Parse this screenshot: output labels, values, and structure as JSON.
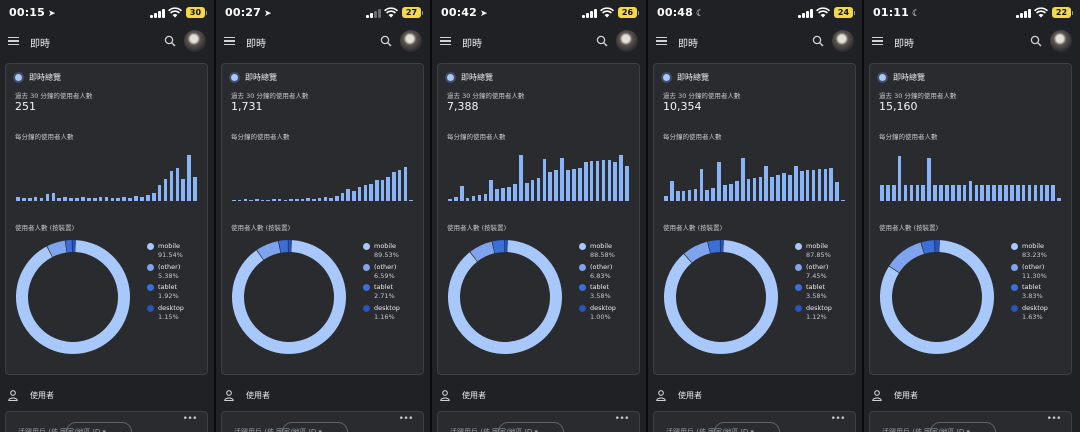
{
  "colors": {
    "accent": "#a8c7fa",
    "bar": "#8ab4f8",
    "mobile": "#a8c7fa",
    "other": "#7ea4ee",
    "tablet": "#3b6ed8",
    "desktop": "#2753bd"
  },
  "screens": [
    {
      "status": {
        "time": "00:15",
        "glyph": "location-arrow",
        "glyph_char": "➤",
        "battery": "30",
        "signal_bars": 4
      },
      "appbar": {
        "title": "即時"
      },
      "card": {
        "title": "即時總覽",
        "sub_label": "過去 30 分鐘的使用者人數",
        "total": "251",
        "per_min_label": "每分鐘的使用者人數",
        "bars": [
          0.08,
          0.06,
          0.06,
          0.08,
          0.06,
          0.14,
          0.16,
          0.06,
          0.08,
          0.06,
          0.06,
          0.08,
          0.06,
          0.06,
          0.08,
          0.08,
          0.06,
          0.06,
          0.08,
          0.06,
          0.1,
          0.08,
          0.12,
          0.16,
          0.3,
          0.42,
          0.56,
          0.62,
          0.42,
          0.86,
          0.46
        ],
        "device_label": "使用者人數 (按裝置)",
        "devices": {
          "mobile": 91.54,
          "other": 5.38,
          "tablet": 1.92,
          "desktop": 1.15
        },
        "legend": [
          {
            "key": "mobile",
            "name": "mobile",
            "pct": "91.54%"
          },
          {
            "key": "other",
            "name": "(other)",
            "pct": "5.38%"
          },
          {
            "key": "tablet",
            "name": "tablet",
            "pct": "1.92%"
          },
          {
            "key": "desktop",
            "name": "desktop",
            "pct": "1.15%"
          }
        ]
      },
      "users_label": "使用者",
      "bottom": {
        "text": "活躍用戶 (依   國家/地區 ID ▾",
        "more": "•••"
      }
    },
    {
      "status": {
        "time": "00:27",
        "glyph": "location-arrow",
        "glyph_char": "➤",
        "battery": "27",
        "signal_bars": 2
      },
      "appbar": {
        "title": "即時"
      },
      "card": {
        "title": "即時總覽",
        "sub_label": "過去 30 分鐘的使用者人數",
        "total": "1,731",
        "per_min_label": "每分鐘的使用者人數",
        "bars": [
          0.02,
          0.02,
          0.04,
          0.02,
          0.03,
          0.02,
          0.02,
          0.04,
          0.03,
          0.02,
          0.03,
          0.03,
          0.04,
          0.06,
          0.03,
          0.06,
          0.08,
          0.06,
          0.1,
          0.16,
          0.22,
          0.18,
          0.26,
          0.3,
          0.32,
          0.4,
          0.4,
          0.46,
          0.54,
          0.58,
          0.64,
          0.02
        ],
        "device_label": "使用者人數 (按裝置)",
        "devices": {
          "mobile": 89.53,
          "other": 6.59,
          "tablet": 2.71,
          "desktop": 1.16
        },
        "legend": [
          {
            "key": "mobile",
            "name": "mobile",
            "pct": "89.53%"
          },
          {
            "key": "other",
            "name": "(other)",
            "pct": "6.59%"
          },
          {
            "key": "tablet",
            "name": "tablet",
            "pct": "2.71%"
          },
          {
            "key": "desktop",
            "name": "desktop",
            "pct": "1.16%"
          }
        ]
      },
      "users_label": "使用者",
      "bottom": {
        "text": "活躍用戶 (依   國家/地區 ID ▾",
        "more": "•••"
      }
    },
    {
      "status": {
        "time": "00:42",
        "glyph": "location-arrow",
        "glyph_char": "➤",
        "battery": "26",
        "signal_bars": 4
      },
      "appbar": {
        "title": "即時"
      },
      "card": {
        "title": "即時總覽",
        "sub_label": "過去 30 分鐘的使用者人數",
        "total": "7,388",
        "per_min_label": "每分鐘的使用者人數",
        "bars": [
          0.04,
          0.08,
          0.28,
          0.06,
          0.1,
          0.12,
          0.14,
          0.4,
          0.22,
          0.24,
          0.26,
          0.32,
          0.86,
          0.34,
          0.4,
          0.44,
          0.8,
          0.54,
          0.58,
          0.82,
          0.58,
          0.6,
          0.62,
          0.74,
          0.76,
          0.76,
          0.78,
          0.78,
          0.74,
          0.86,
          0.66
        ],
        "device_label": "使用者人數 (按裝置)",
        "devices": {
          "mobile": 88.58,
          "other": 6.83,
          "tablet": 3.58,
          "desktop": 1.0
        },
        "legend": [
          {
            "key": "mobile",
            "name": "mobile",
            "pct": "88.58%"
          },
          {
            "key": "other",
            "name": "(other)",
            "pct": "6.83%"
          },
          {
            "key": "tablet",
            "name": "tablet",
            "pct": "3.58%"
          },
          {
            "key": "desktop",
            "name": "desktop",
            "pct": "1.00%"
          }
        ]
      },
      "users_label": "使用者",
      "bottom": {
        "text": "活躍用戶 (依   國家/地區 ID ▾",
        "more": "•••"
      }
    },
    {
      "status": {
        "time": "00:48",
        "glyph": "moon",
        "glyph_char": "☾",
        "battery": "24",
        "signal_bars": 4
      },
      "appbar": {
        "title": "即時"
      },
      "card": {
        "title": "即時總覽",
        "sub_label": "過去 30 分鐘的使用者人數",
        "total": "10,354",
        "per_min_label": "每分鐘的使用者人數",
        "bars": [
          0.1,
          0.38,
          0.18,
          0.18,
          0.2,
          0.22,
          0.6,
          0.2,
          0.24,
          0.74,
          0.3,
          0.32,
          0.38,
          0.82,
          0.42,
          0.44,
          0.46,
          0.66,
          0.46,
          0.5,
          0.52,
          0.5,
          0.66,
          0.56,
          0.58,
          0.58,
          0.6,
          0.6,
          0.62,
          0.36,
          0.02
        ],
        "device_label": "使用者人數 (按裝置)",
        "devices": {
          "mobile": 87.85,
          "other": 7.45,
          "tablet": 3.58,
          "desktop": 1.12
        },
        "legend": [
          {
            "key": "mobile",
            "name": "mobile",
            "pct": "87.85%"
          },
          {
            "key": "other",
            "name": "(other)",
            "pct": "7.45%"
          },
          {
            "key": "tablet",
            "name": "tablet",
            "pct": "3.58%"
          },
          {
            "key": "desktop",
            "name": "desktop",
            "pct": "1.12%"
          }
        ]
      },
      "users_label": "使用者",
      "bottom": {
        "text": "活躍用戶 (依   國家/地區 ID ▾",
        "more": "•••"
      }
    },
    {
      "status": {
        "time": "01:11",
        "glyph": "moon",
        "glyph_char": "☾",
        "battery": "22",
        "signal_bars": 4
      },
      "appbar": {
        "title": "即時"
      },
      "card": {
        "title": "即時總覽",
        "sub_label": "過去 30 分鐘的使用者人數",
        "total": "15,160",
        "per_min_label": "每分鐘的使用者人數",
        "bars": [
          0.3,
          0.3,
          0.3,
          0.84,
          0.3,
          0.3,
          0.3,
          0.3,
          0.82,
          0.3,
          0.3,
          0.3,
          0.3,
          0.3,
          0.3,
          0.38,
          0.3,
          0.3,
          0.3,
          0.3,
          0.3,
          0.3,
          0.3,
          0.3,
          0.3,
          0.3,
          0.3,
          0.3,
          0.3,
          0.3,
          0.06
        ],
        "device_label": "使用者人數 (按裝置)",
        "devices": {
          "mobile": 83.23,
          "other": 11.3,
          "tablet": 3.83,
          "desktop": 1.63
        },
        "legend": [
          {
            "key": "mobile",
            "name": "mobile",
            "pct": "83.23%"
          },
          {
            "key": "other",
            "name": "(other)",
            "pct": "11.30%"
          },
          {
            "key": "tablet",
            "name": "tablet",
            "pct": "3.83%"
          },
          {
            "key": "desktop",
            "name": "desktop",
            "pct": "1.63%"
          }
        ]
      },
      "users_label": "使用者",
      "bottom": {
        "text": "活躍用戶 (依   國家/地區 ID ▾",
        "more": "•••"
      }
    }
  ]
}
